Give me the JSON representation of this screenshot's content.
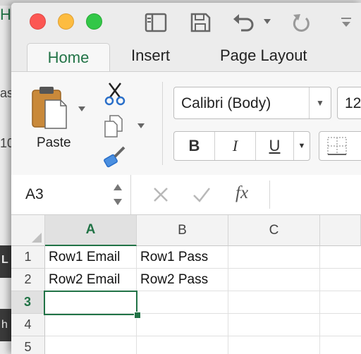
{
  "app": {
    "title_bar": {
      "buttons": [
        "close",
        "minimize",
        "maximize"
      ],
      "toolbar_icons": [
        "sidebar-icon",
        "save-icon",
        "undo-icon",
        "redo-icon",
        "customize-icon"
      ]
    },
    "background_window": {
      "fragments": [
        "H",
        "as",
        "10",
        "L",
        "h"
      ]
    },
    "ribbon": {
      "tabs": [
        "Home",
        "Insert",
        "Page Layout"
      ],
      "active_tab": "Home",
      "clipboard": {
        "paste_label": "Paste"
      },
      "font": {
        "name": "Calibri (Body)",
        "size": "12",
        "bold_label": "B",
        "italic_label": "I",
        "underline_label": "U"
      }
    },
    "formula_bar": {
      "name_box": "A3",
      "fx_label": "fx",
      "content": ""
    },
    "sheet": {
      "columns": [
        "A",
        "B",
        "C"
      ],
      "selected_column": "A",
      "rows": [
        {
          "num": "1",
          "cells": [
            "Row1 Email",
            "Row1 Pass",
            ""
          ]
        },
        {
          "num": "2",
          "cells": [
            "Row2 Email",
            "Row2 Pass",
            ""
          ]
        },
        {
          "num": "3",
          "cells": [
            "",
            "",
            ""
          ]
        },
        {
          "num": "4",
          "cells": [
            "",
            "",
            ""
          ]
        },
        {
          "num": "5",
          "cells": [
            "",
            "",
            ""
          ]
        }
      ],
      "active_cell": "A3"
    },
    "colors": {
      "accent": "#217346",
      "close": "#fc5753",
      "minimize": "#fdbc40",
      "maximize": "#33c748"
    }
  }
}
